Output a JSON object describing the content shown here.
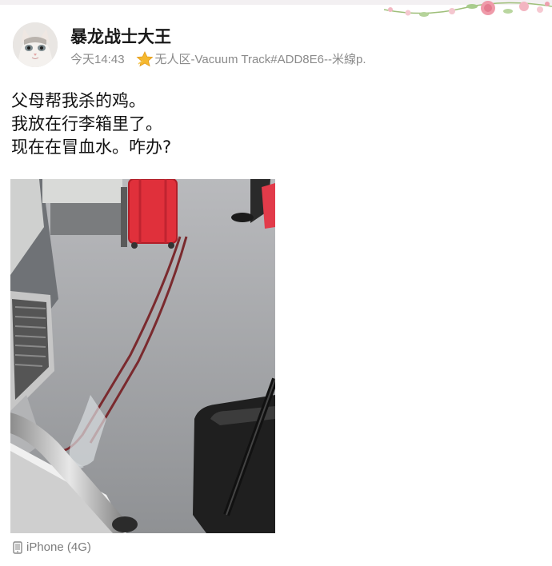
{
  "post": {
    "username": "暴龙战士大王",
    "time": "今天14:43",
    "location_label": "无人区-Vacuum Track#ADD8E6--米線p.",
    "text_lines": [
      "父母帮我杀的鸡。",
      "我放在行李箱里了。",
      "现在在冒血水。咋办?"
    ],
    "source": "iPhone (4G)"
  },
  "icons": {
    "star": "star-badge-icon",
    "phone": "phone-icon",
    "avatar": "cat-avatar",
    "floral": "floral-decoration"
  },
  "colors": {
    "username": "#1a1a1a",
    "meta": "#8a8a8a",
    "star": "#f5b82e",
    "suitcase": "#e0303b"
  }
}
